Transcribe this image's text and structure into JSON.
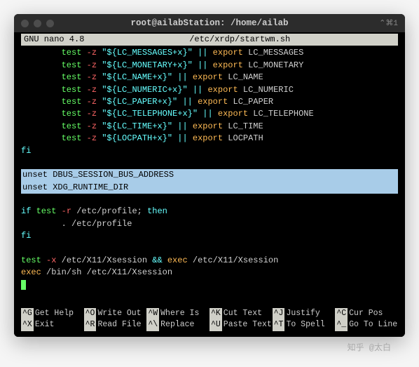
{
  "window": {
    "title": "root@ailabStation: /home/ailab",
    "shortcut": "⌃⌘1"
  },
  "editor": {
    "name": "GNU nano 4.8",
    "file": "/etc/xrdp/startwm.sh"
  },
  "lines": [
    {
      "indent": "        ",
      "t": [
        [
          "kw",
          "test"
        ],
        [
          "plain",
          " "
        ],
        [
          "flag",
          "-z"
        ],
        [
          "plain",
          " "
        ],
        [
          "str",
          "\"${LC_MESSAGES+x}\""
        ],
        [
          "plain",
          " "
        ],
        [
          "op",
          "||"
        ],
        [
          "plain",
          " "
        ],
        [
          "cmd",
          "export"
        ],
        [
          "plain",
          " LC_MESSAGES"
        ]
      ]
    },
    {
      "indent": "        ",
      "t": [
        [
          "kw",
          "test"
        ],
        [
          "plain",
          " "
        ],
        [
          "flag",
          "-z"
        ],
        [
          "plain",
          " "
        ],
        [
          "str",
          "\"${LC_MONETARY+x}\""
        ],
        [
          "plain",
          " "
        ],
        [
          "op",
          "||"
        ],
        [
          "plain",
          " "
        ],
        [
          "cmd",
          "export"
        ],
        [
          "plain",
          " LC_MONETARY"
        ]
      ]
    },
    {
      "indent": "        ",
      "t": [
        [
          "kw",
          "test"
        ],
        [
          "plain",
          " "
        ],
        [
          "flag",
          "-z"
        ],
        [
          "plain",
          " "
        ],
        [
          "str",
          "\"${LC_NAME+x}\""
        ],
        [
          "plain",
          " "
        ],
        [
          "op",
          "||"
        ],
        [
          "plain",
          " "
        ],
        [
          "cmd",
          "export"
        ],
        [
          "plain",
          " LC_NAME"
        ]
      ]
    },
    {
      "indent": "        ",
      "t": [
        [
          "kw",
          "test"
        ],
        [
          "plain",
          " "
        ],
        [
          "flag",
          "-z"
        ],
        [
          "plain",
          " "
        ],
        [
          "str",
          "\"${LC_NUMERIC+x}\""
        ],
        [
          "plain",
          " "
        ],
        [
          "op",
          "||"
        ],
        [
          "plain",
          " "
        ],
        [
          "cmd",
          "export"
        ],
        [
          "plain",
          " LC_NUMERIC"
        ]
      ]
    },
    {
      "indent": "        ",
      "t": [
        [
          "kw",
          "test"
        ],
        [
          "plain",
          " "
        ],
        [
          "flag",
          "-z"
        ],
        [
          "plain",
          " "
        ],
        [
          "str",
          "\"${LC_PAPER+x}\""
        ],
        [
          "plain",
          " "
        ],
        [
          "op",
          "||"
        ],
        [
          "plain",
          " "
        ],
        [
          "cmd",
          "export"
        ],
        [
          "plain",
          " LC_PAPER"
        ]
      ]
    },
    {
      "indent": "        ",
      "t": [
        [
          "kw",
          "test"
        ],
        [
          "plain",
          " "
        ],
        [
          "flag",
          "-z"
        ],
        [
          "plain",
          " "
        ],
        [
          "str",
          "\"${LC_TELEPHONE+x}\""
        ],
        [
          "plain",
          " "
        ],
        [
          "op",
          "||"
        ],
        [
          "plain",
          " "
        ],
        [
          "cmd",
          "export"
        ],
        [
          "plain",
          " LC_TELEPHONE"
        ]
      ]
    },
    {
      "indent": "        ",
      "t": [
        [
          "kw",
          "test"
        ],
        [
          "plain",
          " "
        ],
        [
          "flag",
          "-z"
        ],
        [
          "plain",
          " "
        ],
        [
          "str",
          "\"${LC_TIME+x}\""
        ],
        [
          "plain",
          " "
        ],
        [
          "op",
          "||"
        ],
        [
          "plain",
          " "
        ],
        [
          "cmd",
          "export"
        ],
        [
          "plain",
          " LC_TIME"
        ]
      ]
    },
    {
      "indent": "        ",
      "t": [
        [
          "kw",
          "test"
        ],
        [
          "plain",
          " "
        ],
        [
          "flag",
          "-z"
        ],
        [
          "plain",
          " "
        ],
        [
          "str",
          "\"${LOCPATH+x}\""
        ],
        [
          "plain",
          " "
        ],
        [
          "op",
          "||"
        ],
        [
          "plain",
          " "
        ],
        [
          "cmd",
          "export"
        ],
        [
          "plain",
          " LOCPATH"
        ]
      ]
    },
    {
      "indent": "",
      "t": [
        [
          "fi",
          "fi"
        ]
      ]
    },
    {
      "indent": "",
      "t": [
        [
          "plain",
          ""
        ]
      ]
    },
    {
      "hl": true,
      "indent": "",
      "t": [
        [
          "kw",
          "unset"
        ],
        [
          "plain",
          " DBUS_SESSION_BUS_ADDRESS"
        ]
      ]
    },
    {
      "hl": true,
      "indent": "",
      "t": [
        [
          "kw",
          "unset"
        ],
        [
          "plain",
          " XDG_RUNTIME_DIR"
        ]
      ]
    },
    {
      "indent": "",
      "t": [
        [
          "plain",
          ""
        ]
      ]
    },
    {
      "indent": "",
      "t": [
        [
          "fi",
          "if"
        ],
        [
          "plain",
          " "
        ],
        [
          "kw",
          "test"
        ],
        [
          "plain",
          " "
        ],
        [
          "flag",
          "-r"
        ],
        [
          "plain",
          " /etc/profile; "
        ],
        [
          "fi",
          "then"
        ]
      ]
    },
    {
      "indent": "        ",
      "t": [
        [
          "dot-src",
          ". /etc/profile"
        ]
      ]
    },
    {
      "indent": "",
      "t": [
        [
          "fi",
          "fi"
        ]
      ]
    },
    {
      "indent": "",
      "t": [
        [
          "plain",
          ""
        ]
      ]
    },
    {
      "indent": "",
      "t": [
        [
          "kw",
          "test"
        ],
        [
          "plain",
          " "
        ],
        [
          "flag",
          "-x"
        ],
        [
          "plain",
          " /etc/X11/Xsession "
        ],
        [
          "op",
          "&&"
        ],
        [
          "plain",
          " "
        ],
        [
          "cmd",
          "exec"
        ],
        [
          "plain",
          " /etc/X11/Xsession"
        ]
      ]
    },
    {
      "indent": "",
      "t": [
        [
          "cmd",
          "exec"
        ],
        [
          "plain",
          " /bin/sh /etc/X11/Xsession"
        ]
      ]
    }
  ],
  "help": [
    {
      "k": "^G",
      "l": "Get Help"
    },
    {
      "k": "^O",
      "l": "Write Out"
    },
    {
      "k": "^W",
      "l": "Where Is"
    },
    {
      "k": "^K",
      "l": "Cut Text"
    },
    {
      "k": "^J",
      "l": "Justify"
    },
    {
      "k": "^C",
      "l": "Cur Pos"
    },
    {
      "k": "^X",
      "l": "Exit"
    },
    {
      "k": "^R",
      "l": "Read File"
    },
    {
      "k": "^\\",
      "l": "Replace"
    },
    {
      "k": "^U",
      "l": "Paste Text"
    },
    {
      "k": "^T",
      "l": "To Spell"
    },
    {
      "k": "^_",
      "l": "Go To Line"
    }
  ],
  "watermark": "知乎 @太白"
}
